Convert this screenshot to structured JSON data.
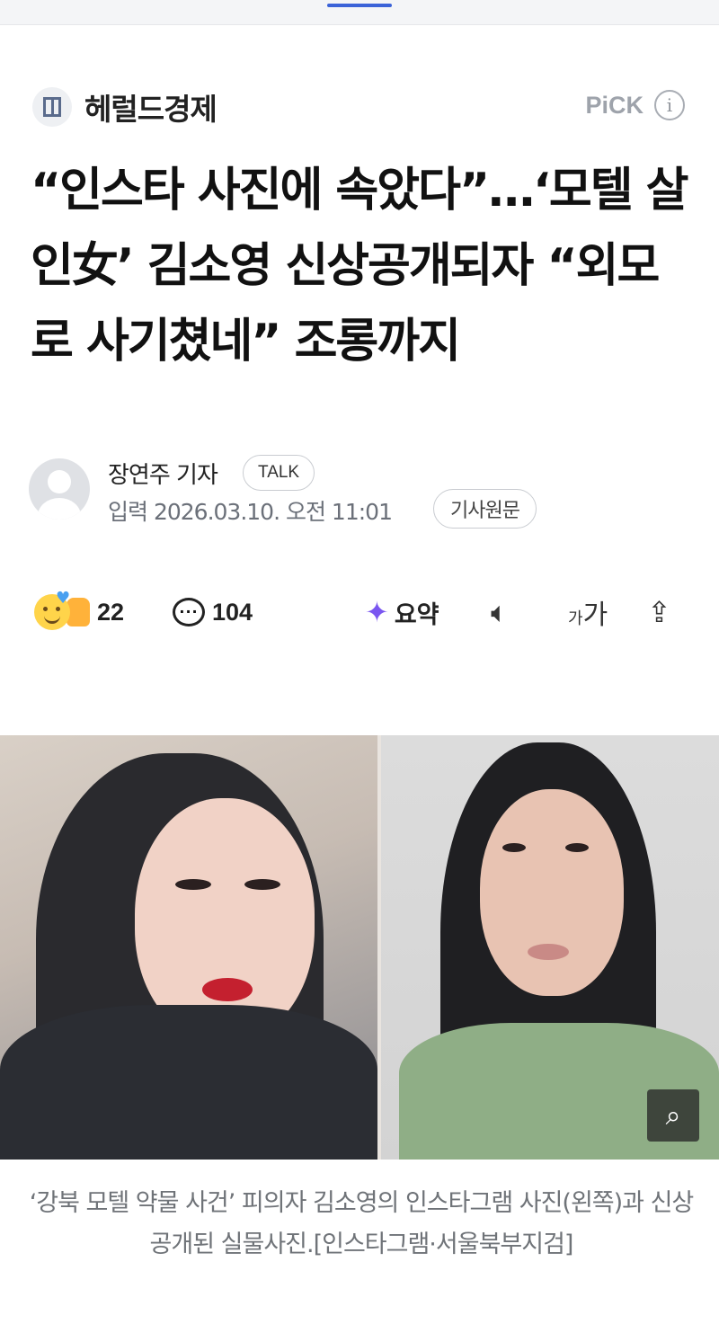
{
  "press": {
    "name": "헤럴드경제",
    "pick_label": "PiCK",
    "info_glyph": "i"
  },
  "article": {
    "headline": "“인스타 사진에 속았다”…‘모텔 살인女’ 김소영 신상공개되자 “외모로 사기쳤네” 조롱까지",
    "reporter": "장연주 기자",
    "talk_label": "TALK",
    "date": "입력 2026.03.10. 오전 11:01",
    "original_label": "기사원문"
  },
  "actions": {
    "reactions_count": "22",
    "comments_count": "104",
    "summary_label": "요약",
    "fontsize_label_small": "가",
    "fontsize_label_large": "가"
  },
  "image": {
    "caption": "‘강북 모텔 약물 사건’ 피의자 김소영의 인스타그램 사진(왼쪽)과 신상공개된 실물사진.[인스타그램·서울북부지검]"
  },
  "icons": {
    "reaction": "reaction-emoji-icon",
    "comment": "comment-icon",
    "summary": "ai-summary-icon",
    "tts": "speaker-icon",
    "font": "font-size-icon",
    "share": "share-icon",
    "zoom": "zoom-icon",
    "info": "info-icon"
  },
  "colors": {
    "accent": "#3b63d8",
    "pick": "#9ea3ab",
    "summary": "#7a56f0"
  }
}
